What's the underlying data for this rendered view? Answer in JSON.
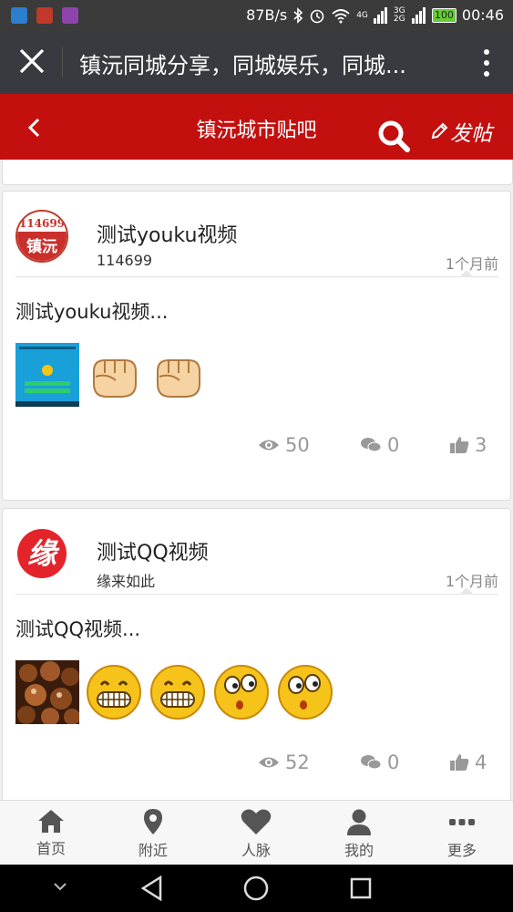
{
  "status_bar": {
    "speed": "87B/s",
    "network_4g": "4G",
    "network_3g2g": "3G 2G",
    "battery": "100",
    "time": "00:46"
  },
  "wechat": {
    "title": "镇沅同城分享，同城娱乐，同城..."
  },
  "header": {
    "title": "镇沅城市贴吧",
    "post_label": "发帖",
    "color": "#c40f0f"
  },
  "posts": [
    {
      "title": "测试youku视频",
      "author": "114699",
      "time": "1个月前",
      "excerpt": "测试youku视频...",
      "avatar_text_top": "114699",
      "avatar_text_bottom": "镇沅",
      "emojis": [
        "fist-icon",
        "fist-icon"
      ],
      "views": "50",
      "comments": "0",
      "likes": "3"
    },
    {
      "title": "测试QQ视频",
      "author": "缘来如此",
      "time": "1个月前",
      "excerpt": "测试QQ视频...",
      "avatar_text": "缘",
      "emojis": [
        "grin-icon",
        "grin-icon",
        "surprised-icon",
        "surprised-icon"
      ],
      "views": "52",
      "comments": "0",
      "likes": "4"
    }
  ],
  "tabs": [
    {
      "label": "首页",
      "icon": "home-icon"
    },
    {
      "label": "附近",
      "icon": "location-pin-icon"
    },
    {
      "label": "人脉",
      "icon": "heart-icon"
    },
    {
      "label": "我的",
      "icon": "user-icon"
    },
    {
      "label": "更多",
      "icon": "more-dots-icon"
    }
  ]
}
